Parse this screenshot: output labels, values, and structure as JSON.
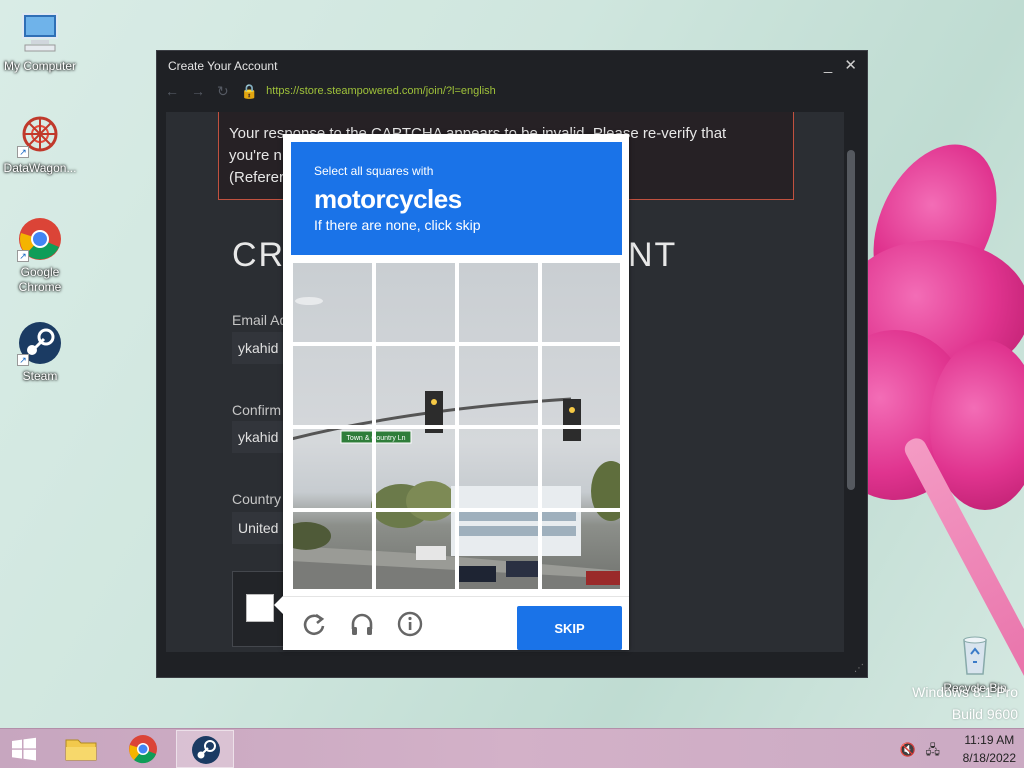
{
  "desktop": {
    "icons": [
      {
        "label": "My Computer"
      },
      {
        "label": "DataWagon..."
      },
      {
        "label": "Google Chrome"
      },
      {
        "label": "Steam"
      },
      {
        "label": "Recycle Bin"
      }
    ],
    "watermark": {
      "line1": "Windows 8.1 Pro",
      "line2": "Build 9600"
    }
  },
  "window": {
    "title": "Create Your Account",
    "url": "https://store.steampowered.com/join/?l=english",
    "error_text_line1": "Your response to the CAPTCHA appears to be invalid. Please re-verify that",
    "error_text_line2": "you're n",
    "error_text_line3": "(Referer",
    "heading_left": "CRE",
    "heading_right": "NT",
    "email_label": "Email Ad",
    "email_value": "ykahid",
    "confirm_label": "Confirm",
    "confirm_value": "ykahid",
    "country_label": "Country",
    "country_value": "United"
  },
  "captcha": {
    "instruction": "Select all squares with",
    "target": "motorcycles",
    "hint": "If there are none, click skip",
    "skip_label": "SKIP",
    "icons": [
      "reload-icon",
      "audio-icon",
      "info-icon"
    ],
    "street_sign": "Town & Country Ln"
  },
  "taskbar": {
    "time": "11:19 AM",
    "date": "8/18/2022"
  },
  "colors": {
    "captcha_blue": "#1a73e8",
    "window_bg": "#1f2125",
    "error_border": "#c1513f"
  }
}
